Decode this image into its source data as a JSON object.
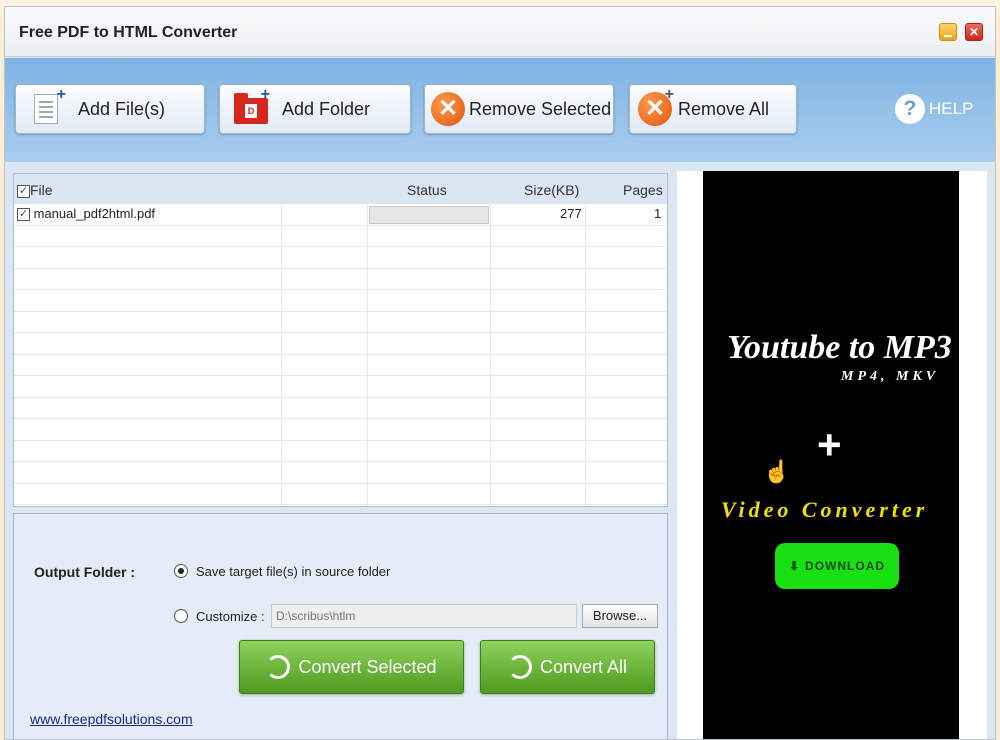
{
  "window": {
    "title": "Free PDF to HTML Converter"
  },
  "toolbar": {
    "add_files": "Add File(s)",
    "add_folder": "Add Folder",
    "remove_selected": "Remove Selected",
    "remove_all": "Remove All",
    "help": "HELP"
  },
  "grid": {
    "columns": {
      "file": "File",
      "status": "Status",
      "size": "Size(KB)",
      "pages": "Pages"
    },
    "rows": [
      {
        "file": "manual_pdf2html.pdf",
        "status": "",
        "size": "277",
        "pages": "1",
        "checked": true
      }
    ]
  },
  "output": {
    "label": "Output Folder :",
    "option_source": "Save target file(s) in source folder",
    "option_customize": "Customize :",
    "path": "D:\\scribus\\htlm",
    "browse": "Browse...",
    "convert_selected": "Convert Selected",
    "convert_all": "Convert All",
    "link": "www.freepdfsolutions.com"
  },
  "ad": {
    "title": "Youtube to MP3",
    "subtitle": "MP4, MKV",
    "plus": "+",
    "video": "Video Converter",
    "download": "DOWNLOAD"
  },
  "colors": {
    "toolbar": "#8fc0ea",
    "convert_green": "#5fae2e",
    "ad_yellow": "#f0e000",
    "ad_green": "#18e012"
  }
}
